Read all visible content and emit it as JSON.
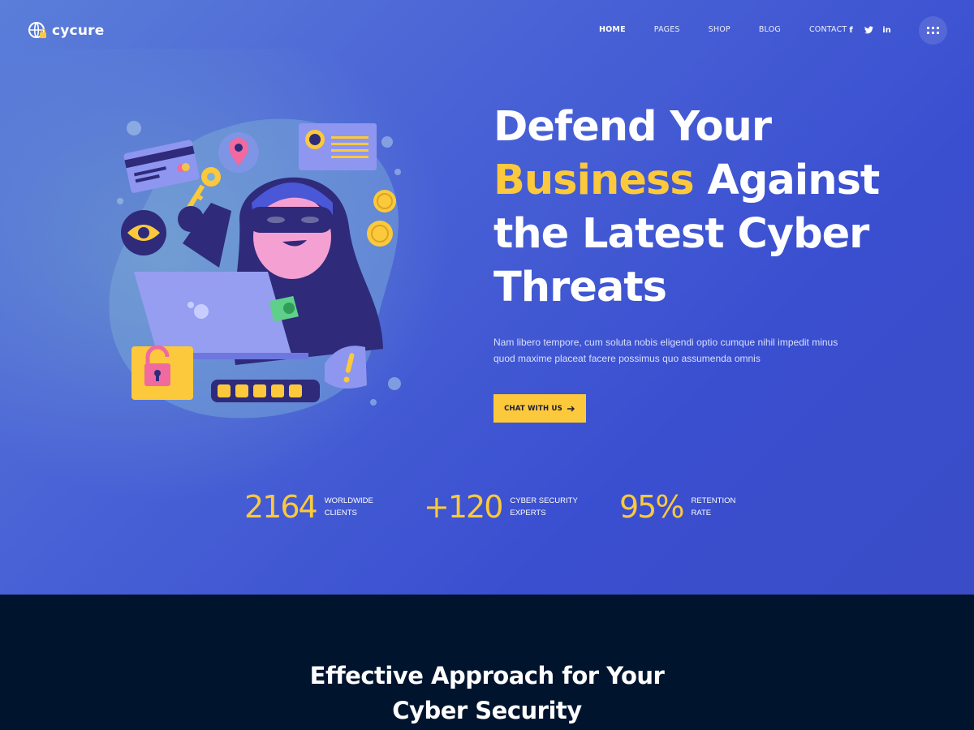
{
  "brand": {
    "name": "cycure"
  },
  "nav": {
    "items": [
      {
        "label": "HOME",
        "active": true
      },
      {
        "label": "PAGES",
        "active": false
      },
      {
        "label": "SHOP",
        "active": false
      },
      {
        "label": "BLOG",
        "active": false
      },
      {
        "label": "CONTACT",
        "active": false
      }
    ]
  },
  "social": {
    "facebook": "f",
    "twitter": "twitter-icon",
    "linkedin": "in"
  },
  "hero": {
    "headline_line1": "Defend Your",
    "headline_highlight": "Business",
    "headline_line2_rest": " Against",
    "headline_line3": "the Latest Cyber",
    "headline_line4": "Threats",
    "description": "Nam libero tempore, cum soluta nobis eligendi optio cumque nihil impedit minus quod maxime placeat facere possimus quo assumenda omnis",
    "cta_label": "CHAT WITH US"
  },
  "stats": [
    {
      "value": "2164",
      "label_line1": "WORLDWIDE",
      "label_line2": "CLIENTS"
    },
    {
      "value": "+120",
      "label_line1": "CYBER SECURITY",
      "label_line2": "EXPERTS"
    },
    {
      "value": "95%",
      "label_line1": "RETENTION",
      "label_line2": "RATE"
    }
  ],
  "section": {
    "title_line1": "Effective Approach for Your",
    "title_line2": "Cyber Security"
  },
  "colors": {
    "accent": "#fbc93b",
    "hero_blue": "#3a4fd0",
    "dark_bg": "#01142e"
  }
}
